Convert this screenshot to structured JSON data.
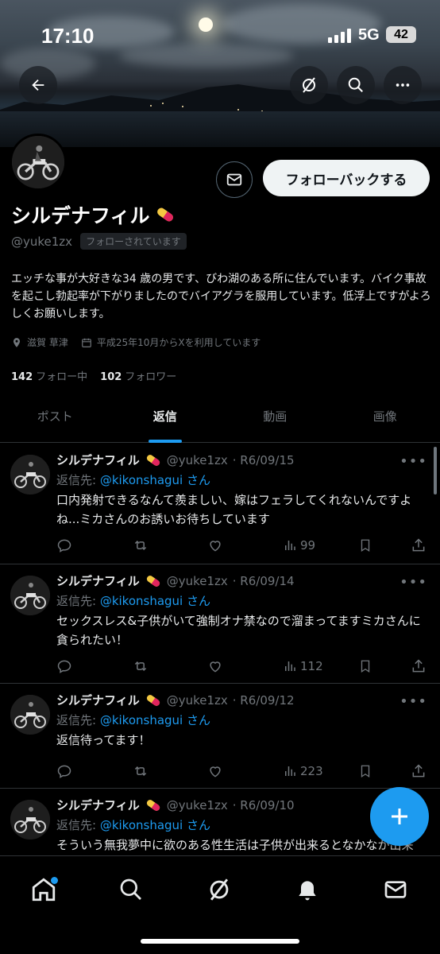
{
  "status_bar": {
    "time": "17:10",
    "network": "5G",
    "battery": "42"
  },
  "profile": {
    "name": "シルデナフィル",
    "handle": "@yuke1zx",
    "follows_you": "フォローされています",
    "follow_back_label": "フォローバックする",
    "bio": "エッチな事が大好きな34 歳の男です、びわ湖のある所に住んでいます。バイク事故を起こし勃起率が下がりましたのでバイアグラを服用しています。低浮上ですがよろしくお願いします。",
    "location": "滋賀 草津",
    "joined": "平成25年10月からXを利用しています",
    "following_count": "142",
    "following_label": "フォロー中",
    "followers_count": "102",
    "followers_label": "フォロワー",
    "name_emoji": "pill-icon"
  },
  "tabs": [
    "ポスト",
    "返信",
    "動画",
    "画像"
  ],
  "active_tab": "返信",
  "tweets": [
    {
      "name": "シルデナフィル",
      "handle": "@yuke1zx",
      "date": "R6/09/15",
      "reply_prefix": "返信先: ",
      "reply_to": "@kikonshagui さん",
      "text": "口内発射できるなんて羨ましい、嫁はフェラしてくれないんですよね...ミカさんのお誘いお待ちしています",
      "views": "99"
    },
    {
      "name": "シルデナフィル",
      "handle": "@yuke1zx",
      "date": "R6/09/14",
      "reply_prefix": "返信先: ",
      "reply_to": "@kikonshagui さん",
      "text": "セックスレス&子供がいて強制オナ禁なので溜まってますミカさんに貪られたい！",
      "views": "112"
    },
    {
      "name": "シルデナフィル",
      "handle": "@yuke1zx",
      "date": "R6/09/12",
      "reply_prefix": "返信先: ",
      "reply_to": "@kikonshagui さん",
      "text": "返信待ってます！",
      "views": "223"
    },
    {
      "name": "シルデナフィル",
      "handle": "@yuke1zx",
      "date": "R6/09/10",
      "reply_prefix": "返信先: ",
      "reply_to": "@kikonshagui さん",
      "text": "そういう無我夢中に欲のある性生活は子供が出来るとなかなか出来",
      "views": ""
    }
  ],
  "colors": {
    "accent": "#1d9bf0",
    "background": "#000000",
    "muted": "#71767b"
  }
}
